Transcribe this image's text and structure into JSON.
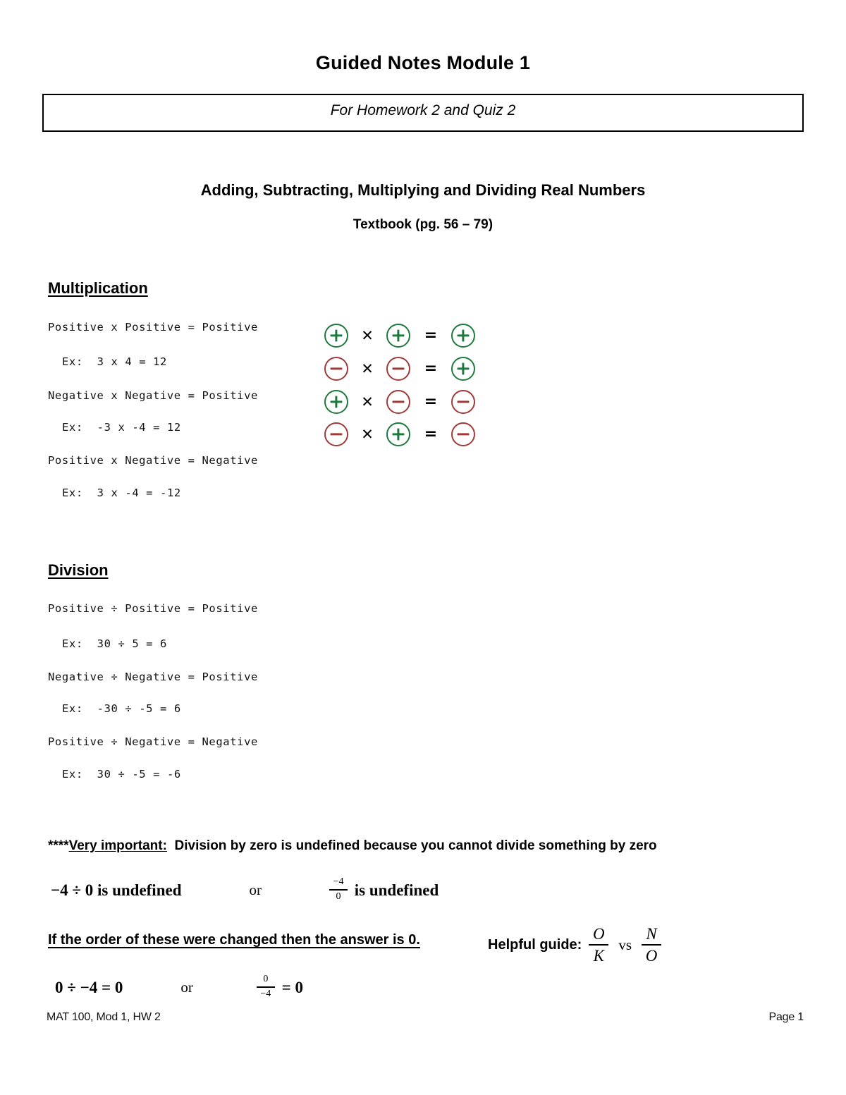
{
  "document": {
    "title": "Guided Notes Module 1",
    "subtitle_box": "For Homework 2 and Quiz 2",
    "topic": "Adding, Subtracting, Multiplying and Dividing Real Numbers",
    "textbook": "Textbook (pg. 56 – 79)"
  },
  "multiplication": {
    "heading": "Multiplication",
    "rules": [
      {
        "rule": "Positive x Positive = Positive",
        "example": "Ex:  3 x 4 = 12"
      },
      {
        "rule": "Negative x Negative = Positive",
        "example": "Ex:  -3 x -4 = 12"
      },
      {
        "rule": "Positive x Negative = Negative",
        "example": "Ex:  3 x -4 = -12"
      }
    ],
    "sign_chart": {
      "times_symbol": "✕",
      "equals_symbol": "=",
      "colors": {
        "positive": "#1E7A3C",
        "negative": "#9E3B38"
      },
      "rows": [
        {
          "a": "+",
          "b": "+",
          "result": "+"
        },
        {
          "a": "-",
          "b": "-",
          "result": "+"
        },
        {
          "a": "+",
          "b": "-",
          "result": "-"
        },
        {
          "a": "-",
          "b": "+",
          "result": "-"
        }
      ]
    }
  },
  "division": {
    "heading": "Division",
    "rules": [
      {
        "rule": "Positive ÷ Positive = Positive",
        "example": "Ex:  30 ÷ 5 = 6"
      },
      {
        "rule": "Negative ÷ Negative = Positive",
        "example": "Ex:  -30 ÷ -5 = 6"
      },
      {
        "rule": "Positive ÷ Negative = Negative",
        "example": "Ex:  30 ÷ -5 = -6"
      }
    ]
  },
  "important": {
    "stars": "****",
    "underlined": "Very important:",
    "statement": "  Division by zero is undefined because you cannot divide something by zero",
    "expr_left": "−4 ÷ 0 is undefined",
    "or": "or",
    "frac_num": "−4",
    "frac_den": "0",
    "frac_tail": " is undefined"
  },
  "order": {
    "statement": "If the order of these were changed then the answer is 0.",
    "expr_left": "0 ÷ −4 = 0",
    "or": "or",
    "frac_num": "0",
    "frac_den": "−4",
    "frac_tail": " = 0"
  },
  "helpful_guide": {
    "label": "Helpful guide:",
    "frac1_num": "O",
    "frac1_den": "K",
    "vs": "vs",
    "frac2_num": "N",
    "frac2_den": "O"
  },
  "footer": {
    "left": "MAT 100, Mod 1, HW 2",
    "right": "Page 1"
  }
}
